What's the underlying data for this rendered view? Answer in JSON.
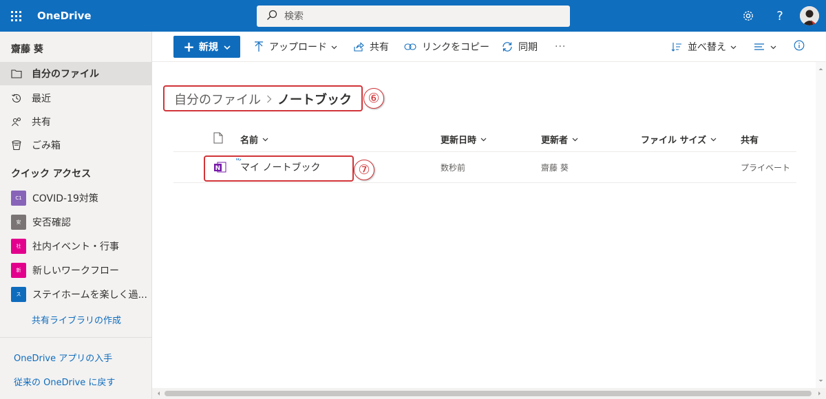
{
  "topbar": {
    "app_title": "OneDrive",
    "search_placeholder": "検索",
    "settings_label": "設定",
    "help_label": "?",
    "brand_color": "#106ebe"
  },
  "sidebar": {
    "user_name": "齋藤 葵",
    "nav": [
      {
        "label": "自分のファイル",
        "icon": "folder-icon",
        "selected": true
      },
      {
        "label": "最近",
        "icon": "history-icon"
      },
      {
        "label": "共有",
        "icon": "people-icon"
      },
      {
        "label": "ごみ箱",
        "icon": "trash-icon"
      }
    ],
    "quick_access_title": "クイック アクセス",
    "quick_access": [
      {
        "label": "COVID-19対策",
        "tile_text": "C1",
        "color": "#8764b8"
      },
      {
        "label": "安否確認",
        "tile_text": "安",
        "color": "#7a7574"
      },
      {
        "label": "社内イベント・行事",
        "tile_text": "社",
        "color": "#e3008c"
      },
      {
        "label": "新しいワークフロー",
        "tile_text": "新",
        "color": "#e3008c"
      },
      {
        "label": "ステイホームを楽しく過...",
        "tile_text": "ス",
        "color": "#0f6cbd"
      }
    ],
    "create_library": "共有ライブラリの作成",
    "get_app": "OneDrive アプリの入手",
    "classic": "従来の OneDrive に戻す"
  },
  "commandbar": {
    "new": "新規",
    "upload": "アップロード",
    "share": "共有",
    "copy_link": "リンクをコピー",
    "sync": "同期",
    "more": "···",
    "sort": "並べ替え"
  },
  "breadcrumb": {
    "parent": "自分のファイル",
    "current": "ノートブック"
  },
  "annotations": {
    "six": "⑥",
    "seven": "⑦"
  },
  "table": {
    "headers": {
      "name": "名前",
      "modified": "更新日時",
      "modified_by": "更新者",
      "size": "ファイル サイズ",
      "sharing": "共有"
    },
    "rows": [
      {
        "name": "マイ ノートブック",
        "modified": "数秒前",
        "modified_by": "齋藤 葵",
        "size": "",
        "sharing": "プライベート"
      }
    ]
  }
}
